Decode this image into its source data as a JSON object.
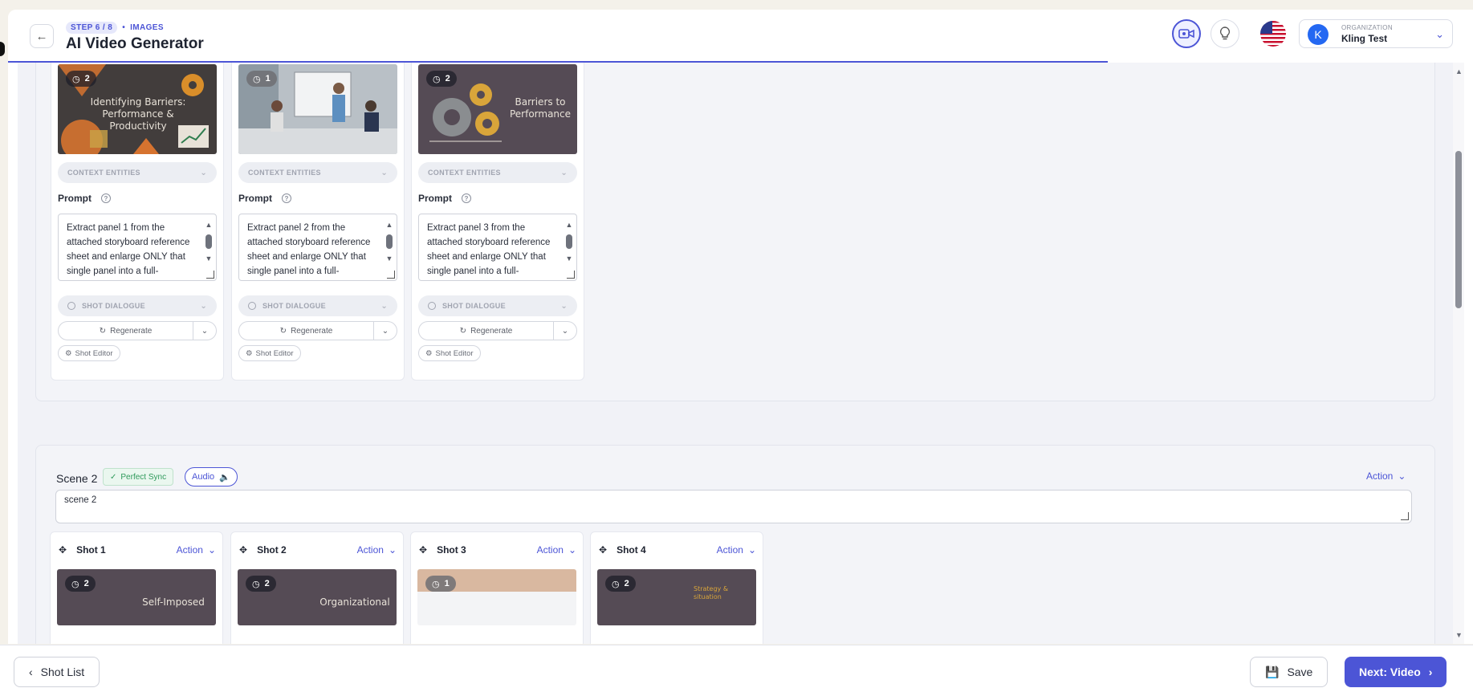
{
  "header": {
    "step_label": "STEP 6 / 8",
    "step_sep": "•",
    "step_name": "IMAGES",
    "title": "AI Video Generator",
    "org_label": "ORGANIZATION",
    "org_name": "Kling Test",
    "org_initial": "K"
  },
  "scene1": {
    "shots": [
      {
        "duration": "2",
        "thumb_text": "Identifying Barriers: Performance & Productivity",
        "context_label": "CONTEXT ENTITIES",
        "prompt_label": "Prompt",
        "prompt_text": "Extract panel 1 from the attached storyboard reference sheet and enlarge ONLY that single panel into a full-",
        "dialogue_label": "SHOT DIALOGUE",
        "regenerate_label": "Regenerate",
        "editor_label": "Shot Editor"
      },
      {
        "duration": "1",
        "thumb_text": "",
        "context_label": "CONTEXT ENTITIES",
        "prompt_label": "Prompt",
        "prompt_text": "Extract panel 2 from the attached storyboard reference sheet and enlarge ONLY that single panel into a full-",
        "dialogue_label": "SHOT DIALOGUE",
        "regenerate_label": "Regenerate",
        "editor_label": "Shot Editor"
      },
      {
        "duration": "2",
        "thumb_text": "Barriers to Performance",
        "context_label": "CONTEXT ENTITIES",
        "prompt_label": "Prompt",
        "prompt_text": "Extract panel 3 from the attached storyboard reference sheet and enlarge ONLY that single panel into a full-",
        "dialogue_label": "SHOT DIALOGUE",
        "regenerate_label": "Regenerate",
        "editor_label": "Shot Editor"
      }
    ]
  },
  "scene2": {
    "title": "Scene 2",
    "sync_label": "Perfect Sync",
    "audio_label": "Audio",
    "action_label": "Action",
    "description": "scene 2",
    "shots": [
      {
        "label": "Shot 1",
        "action": "Action",
        "duration": "2",
        "thumb_text": "Self-Imposed"
      },
      {
        "label": "Shot 2",
        "action": "Action",
        "duration": "2",
        "thumb_text": "Organizational"
      },
      {
        "label": "Shot 3",
        "action": "Action",
        "duration": "1",
        "thumb_text": ""
      },
      {
        "label": "Shot 4",
        "action": "Action",
        "duration": "2",
        "thumb_text": "Strategy & situation"
      }
    ]
  },
  "footer": {
    "shot_list_label": "Shot List",
    "save_label": "Save",
    "next_label": "Next: Video"
  },
  "colors": {
    "accent": "#4c55d6",
    "success": "#2f9a5b",
    "org_avatar": "#2468f2"
  }
}
